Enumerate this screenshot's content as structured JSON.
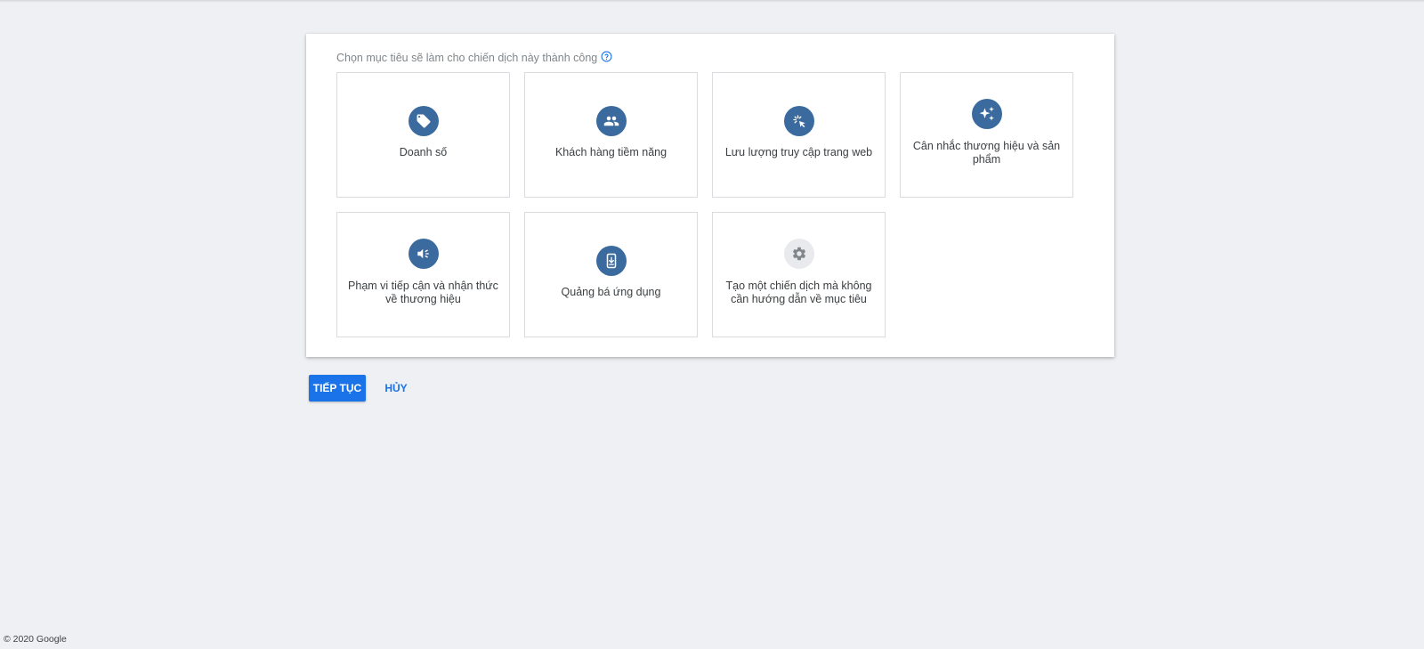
{
  "goal_prompt": "Chọn mục tiêu sẽ làm cho chiến dịch này thành công",
  "help_icon": "help-circle-icon",
  "goals": [
    {
      "label": "Doanh số",
      "icon": "tag-icon"
    },
    {
      "label": "Khách hàng tiềm năng",
      "icon": "people-icon"
    },
    {
      "label": "Lưu lượng truy cập trang web",
      "icon": "cursor-click-icon"
    },
    {
      "label": "Cân nhắc thương hiệu và sản phẩm",
      "icon": "sparkle-icon"
    },
    {
      "label": "Phạm vi tiếp cận và nhận thức về thương hiệu",
      "icon": "megaphone-icon"
    },
    {
      "label": "Quảng bá ứng dụng",
      "icon": "mobile-download-icon"
    },
    {
      "label": "Tạo một chiến dịch mà không cần hướng dẫn về mục tiêu",
      "icon": "gear-icon"
    }
  ],
  "actions": {
    "continue_label": "TIẾP TỤC",
    "cancel_label": "HỦY"
  },
  "footer": {
    "copyright": "© 2020 Google"
  },
  "colors": {
    "accent": "#1a73e8",
    "icon_circle": "#3a6a9e",
    "page_background": "#eff0f3"
  }
}
